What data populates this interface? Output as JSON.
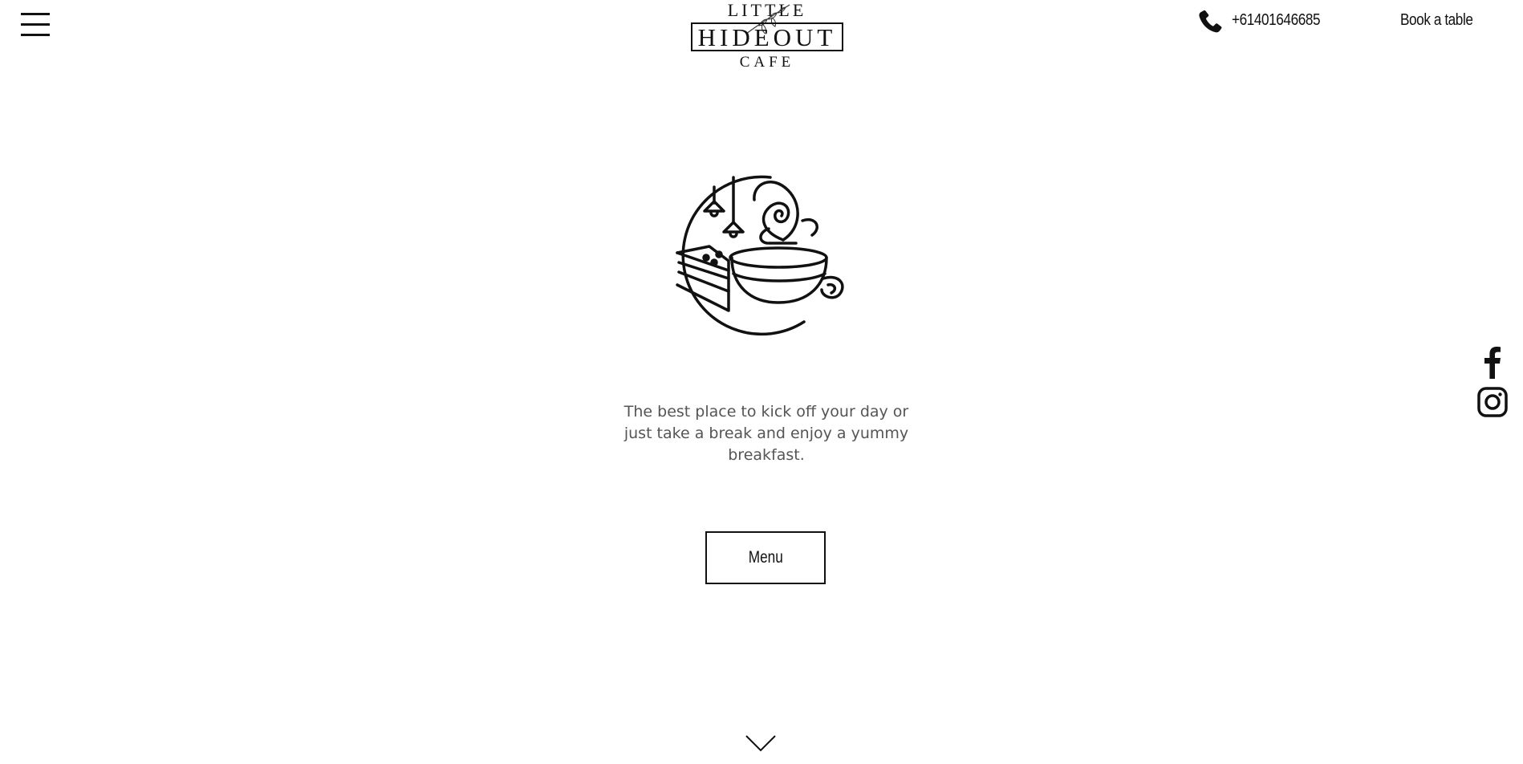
{
  "header": {
    "menu_icon": "hamburger-icon",
    "logo": {
      "line1": "LITTLE",
      "line2": "HIDEOUT",
      "line3": "CAFE"
    },
    "phone_icon": "phone-icon",
    "phone_number": "+61401646685",
    "book_label": "Book a table"
  },
  "hero": {
    "icon": "coffee-cake-icon",
    "tagline": "The best place to kick off your day or just take a break and enjoy a yummy breakfast.",
    "menu_button_label": "Menu",
    "scroll_icon": "chevron-down-icon"
  },
  "social": {
    "items": [
      {
        "name": "facebook-icon"
      },
      {
        "name": "instagram-icon"
      }
    ]
  },
  "colors": {
    "text": "#111111",
    "tagline": "#555555",
    "background": "#ffffff"
  }
}
